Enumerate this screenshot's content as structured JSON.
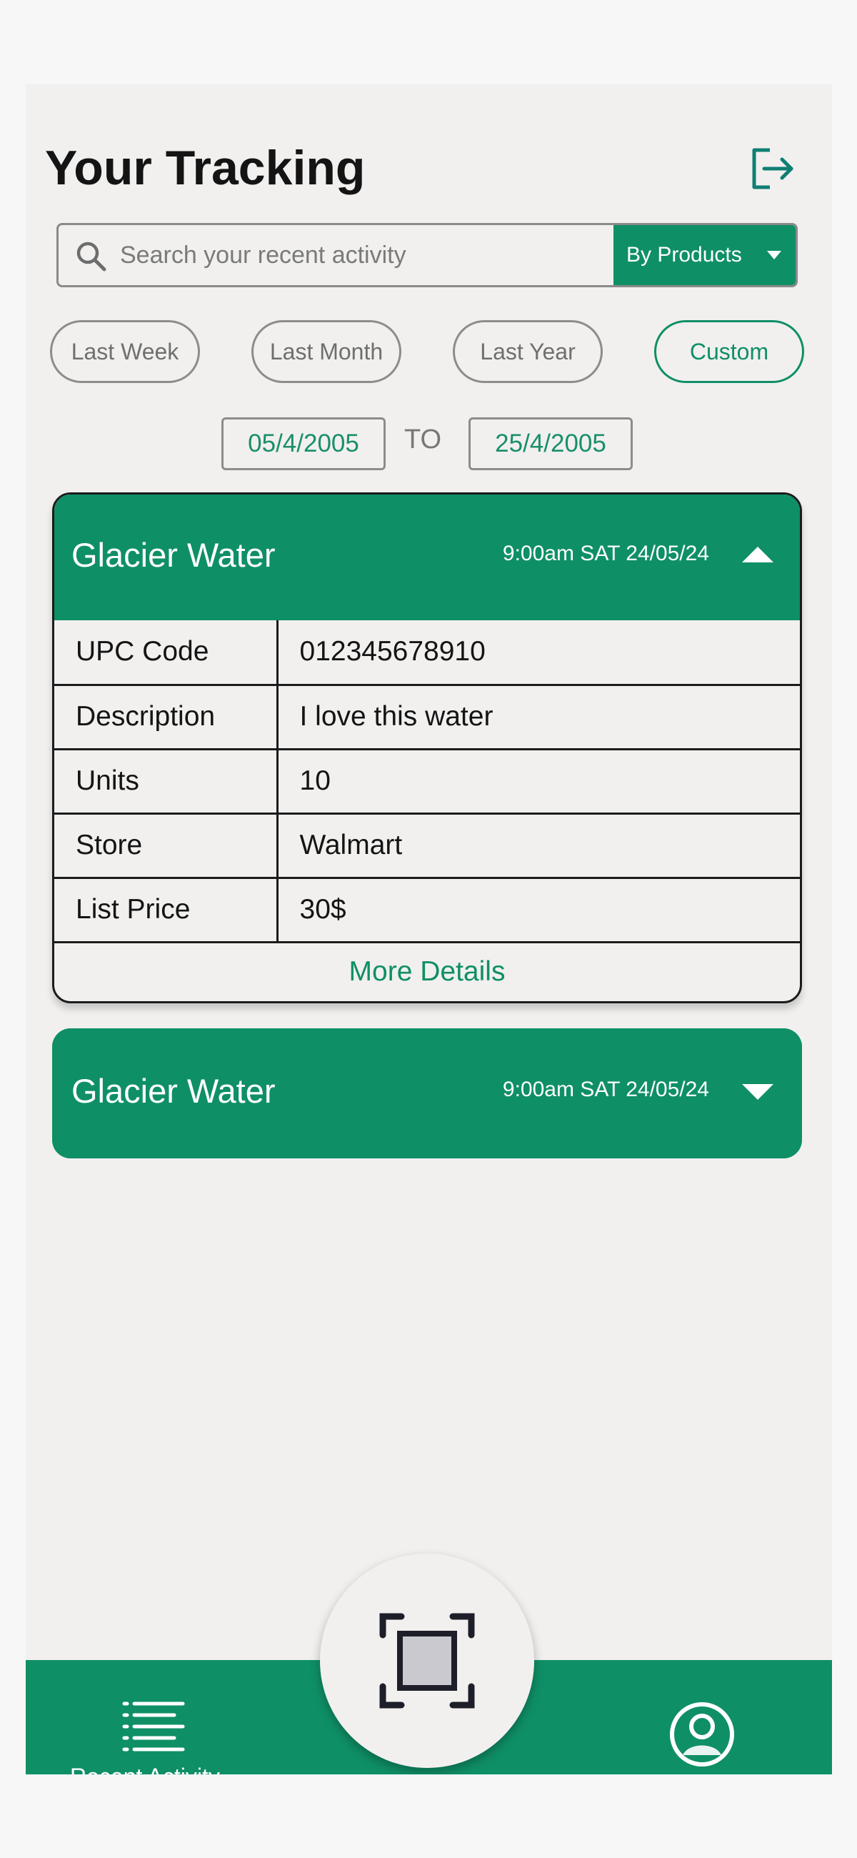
{
  "header": {
    "title": "Your Tracking",
    "logout_icon": "logout-icon"
  },
  "search": {
    "placeholder": "Search your recent activity",
    "filter_selected": "By Products"
  },
  "filters": [
    "Last Week",
    "Last Month",
    "Last Year",
    "Custom"
  ],
  "active_filter": "Custom",
  "date_range": {
    "from": "05/4/2005",
    "separator": "TO",
    "to": "25/4/2005"
  },
  "items": [
    {
      "name": "Glacier Water",
      "time": "9:00am SAT 24/05/24",
      "expanded": true,
      "details": [
        {
          "key": "UPC Code",
          "value": "012345678910"
        },
        {
          "key": "Description",
          "value": "I love this water"
        },
        {
          "key": "Units",
          "value": "10"
        },
        {
          "key": "Store",
          "value": "Walmart"
        },
        {
          "key": "List Price",
          "value": "30$"
        }
      ],
      "more_label": "More Details"
    },
    {
      "name": "Glacier Water",
      "time": "9:00am SAT 24/05/24",
      "expanded": false
    }
  ],
  "bottom_nav": {
    "left_label": "Recent Activity",
    "left_icon": "list-icon",
    "center_icon": "scan-icon",
    "right_icon": "profile-icon"
  },
  "colors": {
    "accent": "#0f8f66",
    "background": "#f1f0ef",
    "text": "#141414"
  }
}
